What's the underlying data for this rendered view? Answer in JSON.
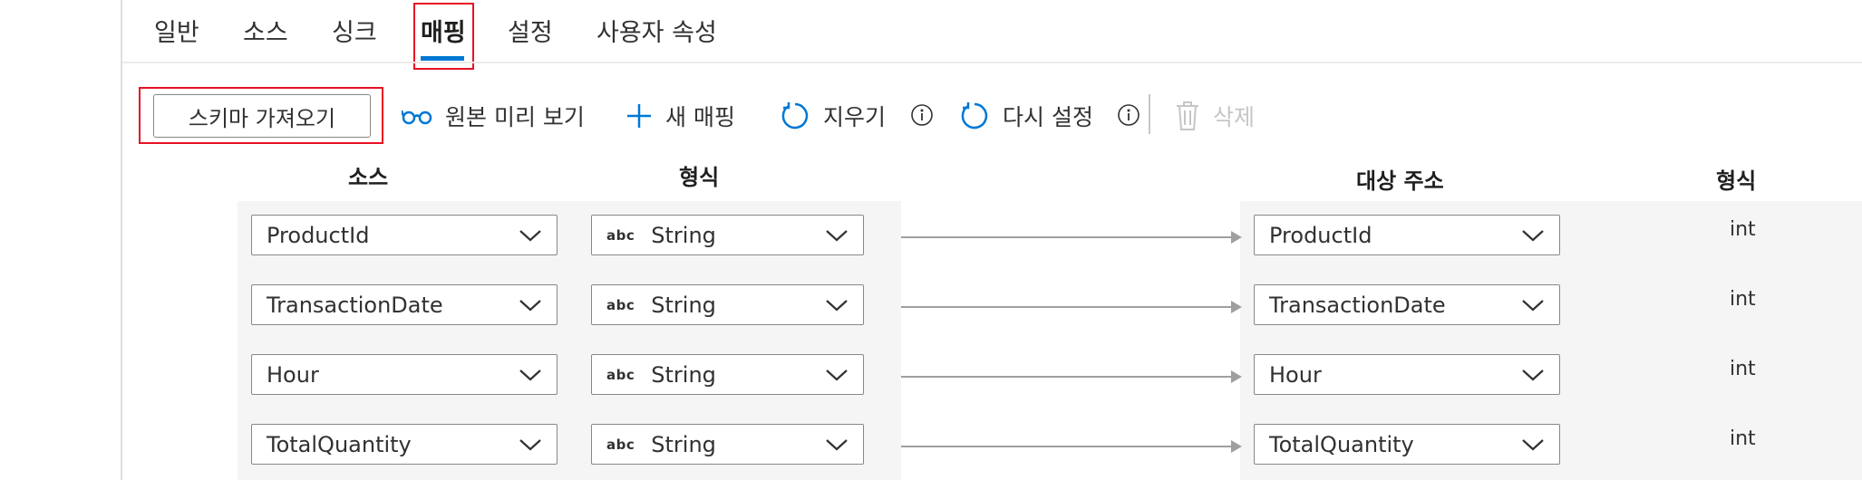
{
  "tabs": [
    "일반",
    "소스",
    "싱크",
    "매핑",
    "설정",
    "사용자 속성"
  ],
  "active_tab": "매핑",
  "toolbar": {
    "import_schema": "스키마 가져오기",
    "preview_source": "원본 미리 보기",
    "new_mapping": "새 매핑",
    "clear": "지우기",
    "reset": "다시 설정",
    "delete": "삭제"
  },
  "columns": {
    "source": "소스",
    "source_type": "형식",
    "destination": "대상 주소",
    "dest_type": "형식"
  },
  "mappings": [
    {
      "source": "ProductId",
      "source_type_badge": "abc",
      "source_type": "String",
      "destination": "ProductId",
      "dest_type": "int"
    },
    {
      "source": "TransactionDate",
      "source_type_badge": "abc",
      "source_type": "String",
      "destination": "TransactionDate",
      "dest_type": "int"
    },
    {
      "source": "Hour",
      "source_type_badge": "abc",
      "source_type": "String",
      "destination": "Hour",
      "dest_type": "int"
    },
    {
      "source": "TotalQuantity",
      "source_type_badge": "abc",
      "source_type": "String",
      "destination": "TotalQuantity",
      "dest_type": "int"
    }
  ],
  "colors": {
    "accent": "#0078d4",
    "highlight_box": "#e81123",
    "disabled": "#c8c6c4"
  },
  "icons": [
    "glasses-icon",
    "plus-icon",
    "refresh-icon",
    "info-icon",
    "trash-icon",
    "chevron-down-icon"
  ]
}
